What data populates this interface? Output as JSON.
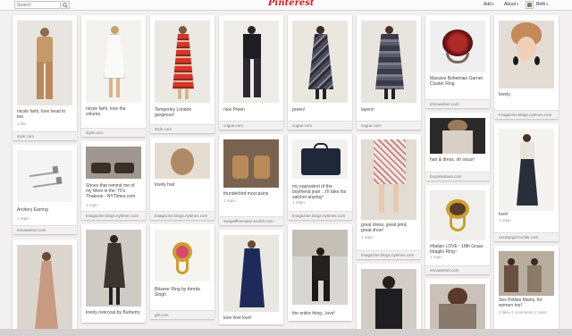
{
  "header": {
    "search_placeholder": "Search",
    "logo": "Pinterest",
    "nav_add": "Add",
    "nav_about": "About",
    "nav_user": "Beth"
  },
  "pins": [
    {
      "desc": "nicole farhi, love head to toe.",
      "stats": "1 like",
      "source": "style.com"
    },
    {
      "desc": "Archery Earring",
      "stats": "1 repin",
      "source": "ericawelner.com"
    },
    {
      "desc": "",
      "stats": "",
      "source": ""
    },
    {
      "desc": "nicole farhi, love the volume.",
      "stats": "",
      "source": "style.com"
    },
    {
      "desc": "Shoes that remind me of my Mom in the '70's Thakoon - NYTimes.com",
      "stats": "1 repin",
      "source": "tmagazine.blogs.nytimes.com"
    },
    {
      "desc": "lovely overcoat by Burberry",
      "stats": "",
      "source": ""
    },
    {
      "desc": "Temperley London gorgeous!",
      "stats": "",
      "source": "style.com"
    },
    {
      "desc": "lovely hair",
      "stats": "",
      "source": "tmagazine.blogs.nytimes.com"
    },
    {
      "desc": "Bikaner Ring by Amrita Singh",
      "stats": "",
      "source": "gilt.com"
    },
    {
      "desc": "nice Preen",
      "stats": "",
      "source": "vogue.com"
    },
    {
      "desc": "thunderbird moccasins",
      "stats": "1 repin",
      "source": "swapelfleemarie.tumblr.com"
    },
    {
      "desc": "love love love!",
      "stats": "",
      "source": ""
    },
    {
      "desc": "preen!",
      "stats": "",
      "source": "vogue.com"
    },
    {
      "desc": "my equivalent of the boyfriend jean ...I'll take his satchel anyday!",
      "stats": "1 repin",
      "source": "tmagazine.blogs.nytimes.com"
    },
    {
      "desc": "the entire thing...love!",
      "stats": "",
      "source": ""
    },
    {
      "desc": "layers!",
      "stats": "",
      "source": "vogue.com"
    },
    {
      "desc": "great dress, great print, great shoe!",
      "stats": "1 repin",
      "source": "tmagazine.blogs.nytimes.com"
    },
    {
      "desc": "",
      "stats": "",
      "source": ""
    },
    {
      "desc": "Massive Bohemian Garnet Cluster Ring",
      "stats": "",
      "source": "ericawelner.com"
    },
    {
      "desc": "hair & dress, oh oscar!",
      "stats": "",
      "source": "bryantestava.com"
    },
    {
      "desc": "#Italian LOVE~ 18th Grass Intaglio Ring~",
      "stats": "1 repin",
      "source": "ericawelner.com"
    },
    {
      "desc": "",
      "stats": "",
      "source": ""
    },
    {
      "desc": "lovely.",
      "stats": "",
      "source": "tmagazine.blogs.nytimes.com"
    },
    {
      "desc": "love!",
      "stats": "1 repin",
      "source": "oscarprgirl.tumblr.com"
    },
    {
      "desc": "Ses Petites Mains, for women too!",
      "stats": "2 likes  2 comments  1 repin",
      "source": ""
    }
  ],
  "colors": {
    "background": "#f2f0f0",
    "brand": "#cb2027"
  }
}
